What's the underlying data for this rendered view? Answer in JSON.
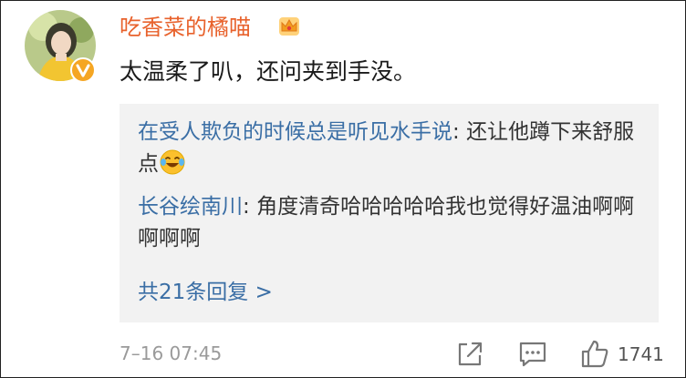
{
  "user": {
    "name": "吃香菜的橘喵",
    "badge_icon": "crown-badge-icon",
    "verified_icon": "verified-v-icon"
  },
  "comment": {
    "text": "太温柔了叭，还问夹到手没。"
  },
  "replies": [
    {
      "author": "在受人欺负的时候总是听见水手说",
      "separator": ": ",
      "text": "还让他蹲下来舒服点",
      "emoji": "laughing-tears-emoji-icon"
    },
    {
      "author": "长谷绘南川",
      "separator": ": ",
      "text": "角度清奇哈哈哈哈哈我也觉得好温油啊啊啊啊啊"
    }
  ],
  "more_replies": "共21条回复 >",
  "footer": {
    "timestamp": "7–16 07:45",
    "like_count": "1741",
    "icons": [
      "share-icon",
      "comment-icon",
      "like-thumb-icon"
    ]
  },
  "colors": {
    "username": "#e8622c",
    "reply_author": "#3a6ea5",
    "reply_bg": "#f2f2f2",
    "muted": "#9a9a9a"
  }
}
